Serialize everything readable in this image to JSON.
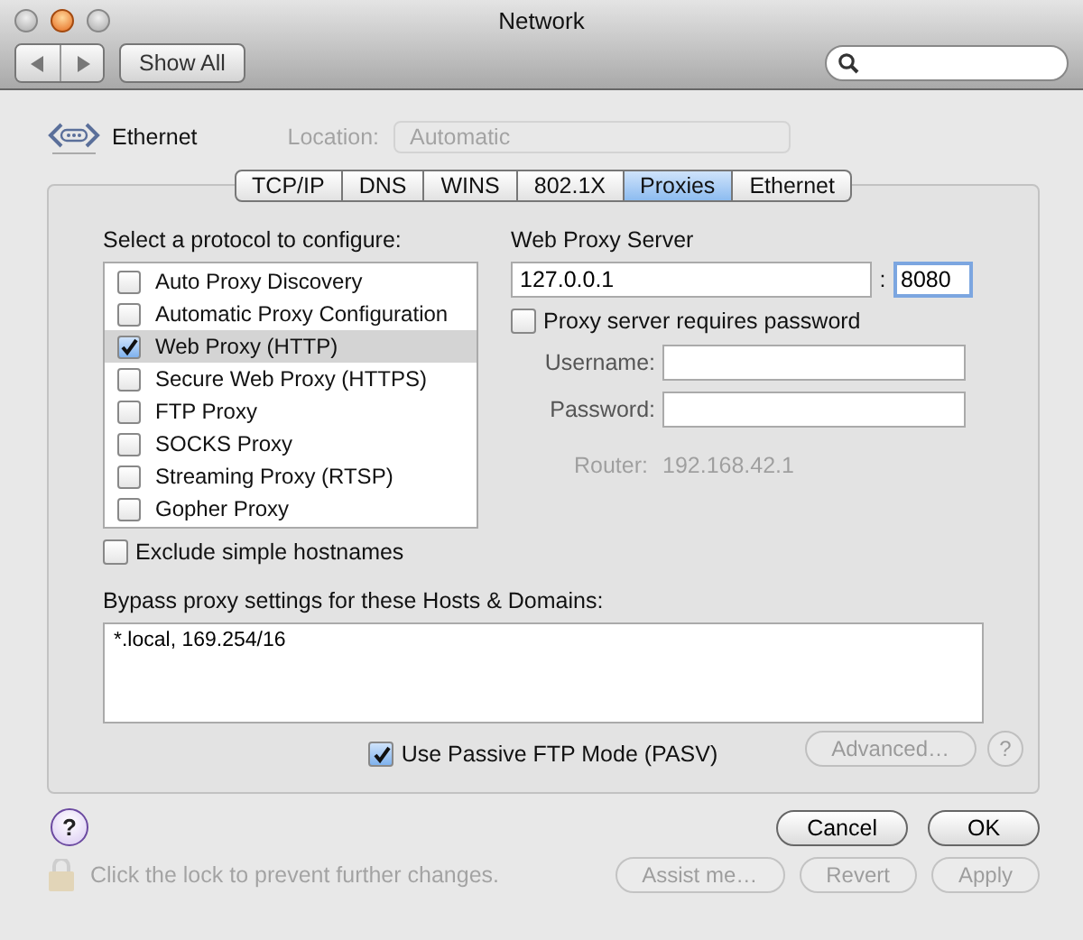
{
  "window": {
    "title": "Network"
  },
  "toolbar": {
    "show_all": "Show All"
  },
  "header": {
    "service": "Ethernet",
    "location_label": "Location:",
    "location_value": "Automatic"
  },
  "tabs": [
    {
      "label": "TCP/IP",
      "selected": false
    },
    {
      "label": "DNS",
      "selected": false
    },
    {
      "label": "WINS",
      "selected": false
    },
    {
      "label": "802.1X",
      "selected": false
    },
    {
      "label": "Proxies",
      "selected": true
    },
    {
      "label": "Ethernet",
      "selected": false
    }
  ],
  "protocols": {
    "label": "Select a protocol to configure:",
    "items": [
      {
        "label": "Auto Proxy Discovery",
        "checked": false,
        "selected": false
      },
      {
        "label": "Automatic Proxy Configuration",
        "checked": false,
        "selected": false
      },
      {
        "label": "Web Proxy (HTTP)",
        "checked": true,
        "selected": true
      },
      {
        "label": "Secure Web Proxy (HTTPS)",
        "checked": false,
        "selected": false
      },
      {
        "label": "FTP Proxy",
        "checked": false,
        "selected": false
      },
      {
        "label": "SOCKS Proxy",
        "checked": false,
        "selected": false
      },
      {
        "label": "Streaming Proxy (RTSP)",
        "checked": false,
        "selected": false
      },
      {
        "label": "Gopher Proxy",
        "checked": false,
        "selected": false
      }
    ]
  },
  "exclude_simple_hostnames": {
    "label": "Exclude simple hostnames",
    "checked": false
  },
  "server": {
    "title": "Web Proxy Server",
    "host": "127.0.0.1",
    "separator": ":",
    "port": "8080",
    "requires_password": {
      "label": "Proxy server requires password",
      "checked": false
    },
    "username_label": "Username:",
    "password_label": "Password:"
  },
  "background": {
    "router_label": "Router:",
    "router_value": "192.168.42.1",
    "advanced": "Advanced…",
    "help": "?",
    "lock_text": "Click the lock to prevent further changes.",
    "assist": "Assist me…",
    "revert": "Revert",
    "apply": "Apply"
  },
  "bypass": {
    "label": "Bypass proxy settings for these Hosts & Domains:",
    "value": "*.local, 169.254/16"
  },
  "passive_ftp": {
    "label": "Use Passive FTP Mode (PASV)",
    "checked": true
  },
  "help": "?",
  "buttons": {
    "cancel": "Cancel",
    "ok": "OK"
  }
}
